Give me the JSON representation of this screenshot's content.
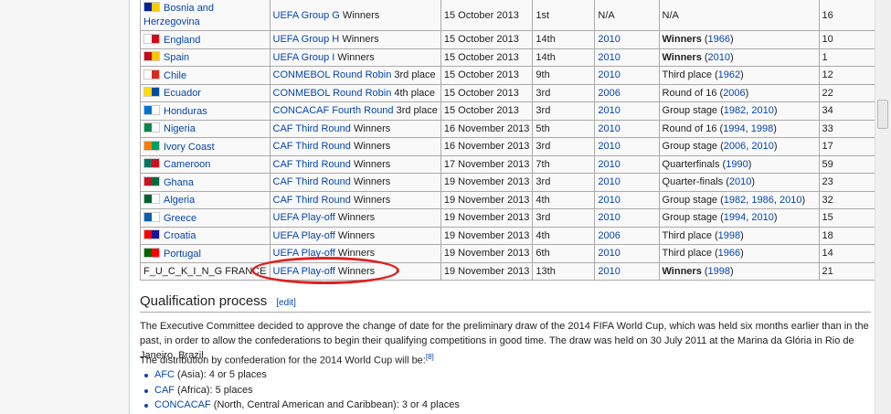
{
  "rows": [
    {
      "team": "Bosnia and Herzegovina",
      "flag": [
        "#002395",
        "#fecb00"
      ],
      "method_link": "UEFA Group G",
      "method_rest": " Winners",
      "date": "15 October 2013",
      "rank": "1st",
      "last": "N/A",
      "last_link": false,
      "best_bold": "",
      "best_text": "N/A",
      "best_links": [],
      "fifa": "16"
    },
    {
      "team": "England",
      "flag": [
        "#fff",
        "#cf081f"
      ],
      "method_link": "UEFA Group H",
      "method_rest": " Winners",
      "date": "15 October 2013",
      "rank": "14th",
      "last": "2010",
      "last_link": true,
      "best_bold": "Winners",
      "best_text": "",
      "best_links": [
        "1966"
      ],
      "fifa": "10"
    },
    {
      "team": "Spain",
      "flag": [
        "#c60b1e",
        "#ffc400"
      ],
      "method_link": "UEFA Group I",
      "method_rest": " Winners",
      "date": "15 October 2013",
      "rank": "14th",
      "last": "2010",
      "last_link": true,
      "best_bold": "Winners",
      "best_text": "",
      "best_links": [
        "2010"
      ],
      "fifa": "1"
    },
    {
      "team": "Chile",
      "flag": [
        "#fff",
        "#d52b1e"
      ],
      "method_link": "CONMEBOL Round Robin",
      "method_rest": " 3rd place",
      "date": "15 October 2013",
      "rank": "9th",
      "last": "2010",
      "last_link": true,
      "best_bold": "",
      "best_text": "Third place",
      "best_links": [
        "1962"
      ],
      "fifa": "12"
    },
    {
      "team": "Ecuador",
      "flag": [
        "#ffdd00",
        "#034ea2"
      ],
      "method_link": "CONMEBOL Round Robin",
      "method_rest": " 4th place",
      "date": "15 October 2013",
      "rank": "3rd",
      "last": "2006",
      "last_link": true,
      "best_bold": "",
      "best_text": "Round of 16",
      "best_links": [
        "2006"
      ],
      "fifa": "22"
    },
    {
      "team": "Honduras",
      "flag": [
        "#0073cf",
        "#fff"
      ],
      "method_link": "CONCACAF Fourth Round",
      "method_rest": " 3rd place",
      "date": "15 October 2013",
      "rank": "3rd",
      "last": "2010",
      "last_link": true,
      "best_bold": "",
      "best_text": "Group stage",
      "best_links": [
        "1982",
        "2010"
      ],
      "fifa": "34"
    },
    {
      "team": "Nigeria",
      "flag": [
        "#008751",
        "#fff"
      ],
      "method_link": "CAF Third Round",
      "method_rest": " Winners",
      "date": "16 November 2013",
      "rank": "5th",
      "last": "2010",
      "last_link": true,
      "best_bold": "",
      "best_text": "Round of 16",
      "best_links": [
        "1994",
        "1998"
      ],
      "fifa": "33"
    },
    {
      "team": "Ivory Coast",
      "flag": [
        "#f77f00",
        "#009e60"
      ],
      "method_link": "CAF Third Round",
      "method_rest": " Winners",
      "date": "16 November 2013",
      "rank": "3rd",
      "last": "2010",
      "last_link": true,
      "best_bold": "",
      "best_text": "Group stage",
      "best_links": [
        "2006",
        "2010"
      ],
      "fifa": "17"
    },
    {
      "team": "Cameroon",
      "flag": [
        "#007a5e",
        "#ce1126"
      ],
      "method_link": "CAF Third Round",
      "method_rest": " Winners",
      "date": "17 November 2013",
      "rank": "7th",
      "last": "2010",
      "last_link": true,
      "best_bold": "",
      "best_text": "Quarterfinals",
      "best_links": [
        "1990"
      ],
      "fifa": "59"
    },
    {
      "team": "Ghana",
      "flag": [
        "#ce1126",
        "#006b3f"
      ],
      "method_link": "CAF Third Round",
      "method_rest": " Winners",
      "date": "19 November 2013",
      "rank": "3rd",
      "last": "2010",
      "last_link": true,
      "best_bold": "",
      "best_text": "Quarter-finals",
      "best_links": [
        "2010"
      ],
      "fifa": "23"
    },
    {
      "team": "Algeria",
      "flag": [
        "#006233",
        "#fff"
      ],
      "method_link": "CAF Third Round",
      "method_rest": " Winners",
      "date": "19 November 2013",
      "rank": "4th",
      "last": "2010",
      "last_link": true,
      "best_bold": "",
      "best_text": "Group stage",
      "best_links": [
        "1982",
        "1986",
        "2010"
      ],
      "fifa": "32"
    },
    {
      "team": "Greece",
      "flag": [
        "#0d5eaf",
        "#fff"
      ],
      "method_link": "UEFA Play-off",
      "method_rest": " Winners",
      "date": "19 November 2013",
      "rank": "3rd",
      "last": "2010",
      "last_link": true,
      "best_bold": "",
      "best_text": "Group stage",
      "best_links": [
        "1994",
        "2010"
      ],
      "fifa": "15"
    },
    {
      "team": "Croatia",
      "flag": [
        "#ff0000",
        "#171796"
      ],
      "method_link": "UEFA Play-off",
      "method_rest": " Winners",
      "date": "19 November 2013",
      "rank": "4th",
      "last": "2006",
      "last_link": true,
      "best_bold": "",
      "best_text": "Third place",
      "best_links": [
        "1998"
      ],
      "fifa": "18"
    },
    {
      "team": "Portugal",
      "flag": [
        "#006600",
        "#ff0000"
      ],
      "method_link": "UEFA Play-off",
      "method_rest": " Winners",
      "date": "19 November 2013",
      "rank": "6th",
      "last": "2010",
      "last_link": true,
      "best_bold": "",
      "best_text": "Third place",
      "best_links": [
        "1966"
      ],
      "fifa": "14"
    },
    {
      "team": "F_U_C_K_I_N_G FRANCE",
      "flag": null,
      "method_link": "UEFA Play-off",
      "method_rest": " Winners",
      "date": "19 November 2013",
      "rank": "13th",
      "last": "2010",
      "last_link": true,
      "best_bold": "Winners",
      "best_text": "",
      "best_links": [
        "1998"
      ],
      "fifa": "21"
    }
  ],
  "section": {
    "title": "Qualification process",
    "edit": "[edit]"
  },
  "para1": "The Executive Committee decided to approve the change of date for the preliminary draw of the 2014 FIFA World Cup, which was held six months earlier than in the past, in order to allow the confederations to begin their qualifying competitions in good time. The draw was held on 30 July 2011 at the Marina da Glória in Rio de Janeiro, Brazil.",
  "para2": "The distribution by confederation for the 2014 World Cup will be:",
  "para2_ref": "[8]",
  "bullets": [
    {
      "link": "AFC",
      "text": " (Asia): 4 or 5 places"
    },
    {
      "link": "CAF",
      "text": " (Africa): 5 places"
    },
    {
      "link": "CONCACAF",
      "text": " (North, Central American and Caribbean): 3 or 4 places"
    }
  ],
  "annotation_color": "#e02020"
}
